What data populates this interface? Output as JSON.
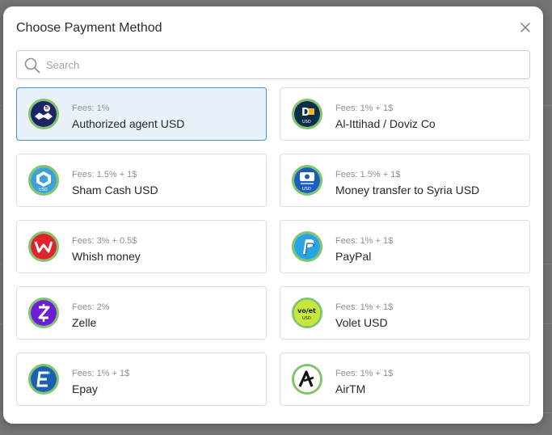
{
  "modal": {
    "title": "Choose Payment Method",
    "close_icon": "close-icon"
  },
  "search": {
    "placeholder": "Search",
    "value": "",
    "icon": "search-icon"
  },
  "methods": [
    {
      "fees": "Fees: 1%",
      "name": "Authorized agent USD",
      "icon": "handshake-icon",
      "selected": true
    },
    {
      "fees": "Fees: 1% + 1$",
      "name": "Al-Ittihad / Doviz Co",
      "icon": "doviz-logo-icon",
      "selected": false
    },
    {
      "fees": "Fees: 1.5% + 1$",
      "name": "Sham Cash USD",
      "icon": "sham-cash-logo-icon",
      "selected": false
    },
    {
      "fees": "Fees: 1.5% + 1$",
      "name": "Money transfer to Syria USD",
      "icon": "money-transfer-logo-icon",
      "selected": false
    },
    {
      "fees": "Fees: 3% + 0.5$",
      "name": "Whish money",
      "icon": "whish-logo-icon",
      "selected": false
    },
    {
      "fees": "Fees: 1% + 1$",
      "name": "PayPal",
      "icon": "paypal-logo-icon",
      "selected": false
    },
    {
      "fees": "Fees: 2%",
      "name": "Zelle",
      "icon": "zelle-logo-icon",
      "selected": false
    },
    {
      "fees": "Fees: 1% + 1$",
      "name": "Volet USD",
      "icon": "volet-logo-icon",
      "selected": false
    },
    {
      "fees": "Fees: 1% + 1$",
      "name": "Epay",
      "icon": "epay-logo-icon",
      "selected": false
    },
    {
      "fees": "Fees: 1% + 1$",
      "name": "AirTM",
      "icon": "airtm-logo-icon",
      "selected": false
    }
  ],
  "logo_marks": {
    "doviz": "D",
    "doviz_sub": "USD",
    "sham_sub": "USD",
    "transfer_sub": "USD",
    "volet_top": "vo/et",
    "volet_sub": "USD"
  },
  "colors": {
    "selected_bg": "#e9f2fb",
    "selected_border": "#3d93d8",
    "logo_ring": "#7fc56b"
  }
}
